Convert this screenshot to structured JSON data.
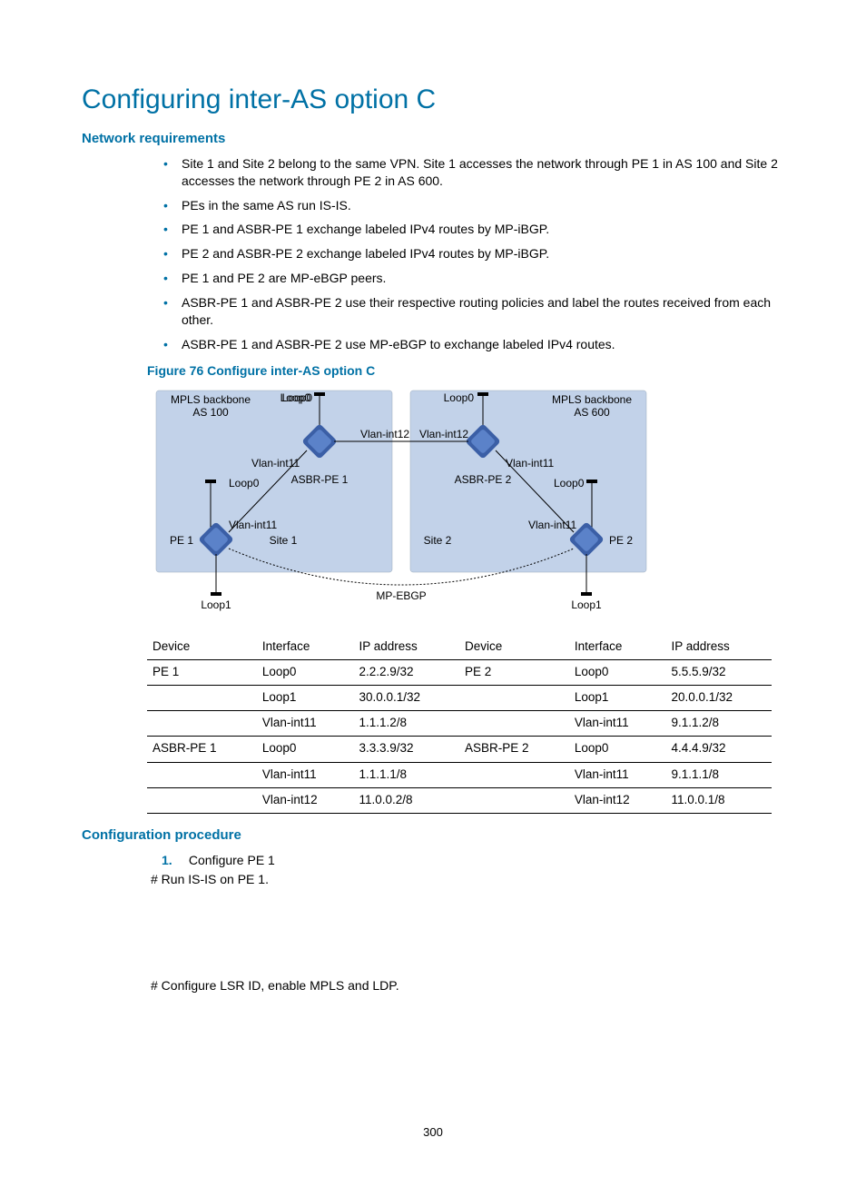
{
  "title": "Configuring inter-AS option C",
  "sections": {
    "netreq_heading": "Network requirements",
    "figure_caption": "Figure 76 Configure inter-AS option C",
    "confproc_heading": "Configuration procedure"
  },
  "requirements": [
    "Site 1 and Site 2 belong to the same VPN. Site 1 accesses the network through PE 1 in AS 100 and Site 2 accesses the network through PE 2 in AS 600.",
    "PEs in the same AS run IS-IS.",
    "PE 1 and ASBR-PE 1 exchange labeled IPv4 routes by MP-iBGP.",
    "PE 2 and ASBR-PE 2 exchange labeled IPv4 routes by MP-iBGP.",
    "PE 1 and PE 2 are MP-eBGP peers.",
    "ASBR-PE 1 and ASBR-PE 2 use their respective routing policies and label the routes received from each other.",
    "ASBR-PE 1 and ASBR-PE 2 use MP-eBGP to exchange labeled IPv4 routes."
  ],
  "diagram": {
    "left_as": "MPLS backbone\nAS 100",
    "right_as": "MPLS backbone\nAS 600",
    "labels": {
      "loop0": "Loop0",
      "loop1": "Loop1",
      "vlan11": "Vlan-int11",
      "vlan12": "Vlan-int12",
      "asbr_pe1": "ASBR-PE 1",
      "asbr_pe2": "ASBR-PE 2",
      "pe1": "PE 1",
      "pe2": "PE 2",
      "site1": "Site 1",
      "site2": "Site 2",
      "mpebgp": "MP-EBGP"
    }
  },
  "table": {
    "headers": [
      "Device",
      "Interface",
      "IP address",
      "Device",
      "Interface",
      "IP address"
    ],
    "rows": [
      [
        "PE 1",
        "Loop0",
        "2.2.2.9/32",
        "PE 2",
        "Loop0",
        "5.5.5.9/32"
      ],
      [
        "",
        "Loop1",
        "30.0.0.1/32",
        "",
        "Loop1",
        "20.0.0.1/32"
      ],
      [
        "",
        "Vlan-int11",
        "1.1.1.2/8",
        "",
        "Vlan-int11",
        "9.1.1.2/8"
      ],
      [
        "ASBR-PE 1",
        "Loop0",
        "3.3.3.9/32",
        "ASBR-PE 2",
        "Loop0",
        "4.4.4.9/32"
      ],
      [
        "",
        "Vlan-int11",
        "1.1.1.1/8",
        "",
        "Vlan-int11",
        "9.1.1.1/8"
      ],
      [
        "",
        "Vlan-int12",
        "11.0.0.2/8",
        "",
        "Vlan-int12",
        "11.0.0.1/8"
      ]
    ]
  },
  "procedure": {
    "step1_num": "1.",
    "step1_text": "Configure PE 1",
    "step1_sub1": "# Run IS-IS on PE 1.",
    "step1_sub2": "# Configure LSR ID, enable MPLS and LDP."
  },
  "page_number": "300"
}
